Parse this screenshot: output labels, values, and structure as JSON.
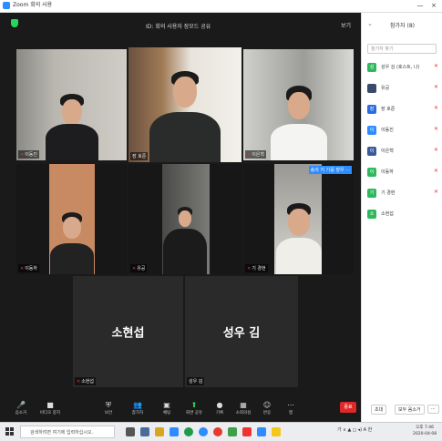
{
  "window": {
    "title": "Zoom 회의 사용",
    "minimize_glyph": "—",
    "close_glyph": "×"
  },
  "meeting": {
    "title": "ID: 회의 사용자 장모드 공유",
    "view_button": "보기",
    "speaker_badge": "송의 지 기를 장우 ···"
  },
  "participants_tiles": [
    {
      "name": "이동진"
    },
    {
      "name": "장 호준"
    },
    {
      "name": "이은혁"
    },
    {
      "name": "이동하"
    },
    {
      "name": "유공"
    },
    {
      "name": "기 경현"
    },
    {
      "name": "소현섭",
      "big": "소현섭"
    },
    {
      "name": "성우 김",
      "big": "성우 김"
    }
  ],
  "toolbar": {
    "items": [
      {
        "icon": "🎤",
        "label": "음소거"
      },
      {
        "icon": "■",
        "label": "비디오 중지"
      },
      {
        "icon": "⛨",
        "label": "보안"
      },
      {
        "icon": "👥",
        "label": "참가자"
      },
      {
        "icon": "▣",
        "label": "채팅"
      },
      {
        "icon": "⬆",
        "label": "화면 공유"
      },
      {
        "icon": "●",
        "label": "기록"
      },
      {
        "icon": "▦",
        "label": "소회의실"
      },
      {
        "icon": "☺",
        "label": "반응"
      },
      {
        "icon": "⋯",
        "label": "앱"
      }
    ],
    "end_label": "종료"
  },
  "participants_panel": {
    "title": "참가자 (8)",
    "search_placeholder": "참가자 찾기",
    "rows": [
      {
        "initial": "성",
        "name": "성우 김 (호스트, 나)",
        "color": "#2eb85c"
      },
      {
        "initial": "",
        "name": "유공",
        "color": "#3a4a6a"
      },
      {
        "initial": "장",
        "name": "장 호준",
        "color": "#2d6cdf"
      },
      {
        "initial": "이",
        "name": "이동진",
        "color": "#2d8cff"
      },
      {
        "initial": "이",
        "name": "이은혁",
        "color": "#3a5a9a"
      },
      {
        "initial": "이",
        "name": "이동하",
        "color": "#2eb85c"
      },
      {
        "initial": "기",
        "name": "기 경현",
        "color": "#2eb85c"
      },
      {
        "initial": "소",
        "name": "소현섭",
        "color": "#2eb85c"
      }
    ],
    "invite_label": "초대",
    "mute_all_label": "모두 음소거",
    "more_label": "···"
  },
  "taskbar": {
    "search_text": "검색하려면 여기에 입력하십시오.",
    "tray_text": "가 ∧ ▲ ◻ ◂) A 한",
    "time": "오후 7:46",
    "date": "2020-04-08"
  },
  "colors": {
    "speaker_outline": "#e4e443",
    "zoom_blue": "#2d8cff",
    "end_red": "#e02828",
    "muted_red": "#e33333"
  }
}
